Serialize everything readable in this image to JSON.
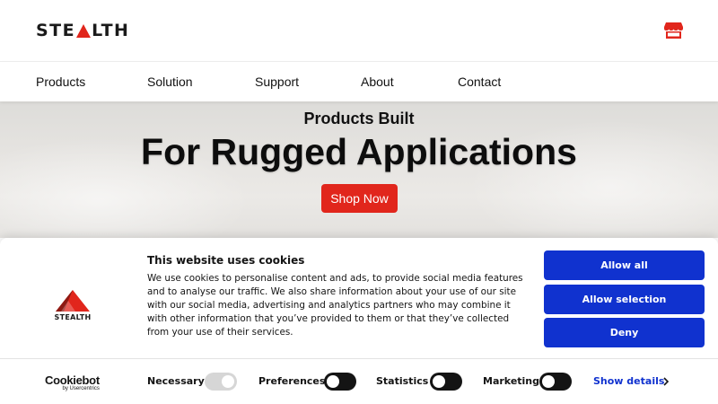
{
  "header": {
    "logo_text_left": "STE",
    "logo_text_right": "LTH",
    "store_icon": "storefront-icon"
  },
  "nav": {
    "items": [
      {
        "label": "Products"
      },
      {
        "label": "Solution"
      },
      {
        "label": "Support"
      },
      {
        "label": "About"
      },
      {
        "label": "Contact"
      }
    ]
  },
  "hero": {
    "subtitle": "Products Built",
    "title": "For Rugged Applications",
    "cta": "Shop Now"
  },
  "cookie_banner": {
    "logo_text": "STEALTH",
    "title": "This website uses cookies",
    "body": "We use cookies to personalise content and ads, to provide social media features and to analyse our traffic. We also share information about your use of our site with our social media, advertising and analytics partners who may combine it with other information that you’ve provided to them or that they’ve collected from your use of their services.",
    "buttons": {
      "allow_all": "Allow all",
      "allow_selection": "Allow selection",
      "deny": "Deny"
    },
    "cookiebot_name": "Cookiebot",
    "cookiebot_by": "by Usercentrics",
    "toggles": [
      {
        "label": "Necessary",
        "on": true,
        "disabled": true
      },
      {
        "label": "Preferences",
        "on": false
      },
      {
        "label": "Statistics",
        "on": false
      },
      {
        "label": "Marketing",
        "on": false
      }
    ],
    "show_details": "Show details"
  },
  "colors": {
    "brand_red": "#e1261c",
    "cookie_blue": "#1032cf"
  }
}
